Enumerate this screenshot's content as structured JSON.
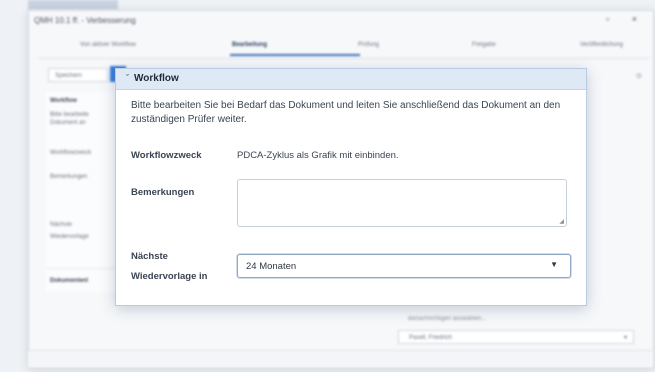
{
  "window": {
    "title": "QMH 10.1 ff. - Verbesserung",
    "controls": "▫ ×"
  },
  "steps": [
    {
      "label": "Von aktiver Workflow"
    },
    {
      "label": "Bearbeitung"
    },
    {
      "label": "Prüfung"
    },
    {
      "label": "Freigabe"
    },
    {
      "label": "Veröffentlichung"
    }
  ],
  "background": {
    "save_label": "Speichern",
    "left_items": [
      "Workflow",
      "Bitte bearbeite",
      "Dokument an",
      "Workflowzweck",
      "Bemerkungen",
      "Nächste",
      "Wiedervorlage",
      "Dokumentenl"
    ],
    "select_label": "Benachrichtigen auswählen...",
    "select_value": "Pasell, Friedrich",
    "right_icon": "⊙"
  },
  "dialog": {
    "title": "Workflow",
    "intro": "Bitte bearbeiten Sie bei Bedarf das Dokument und leiten Sie anschließend das Dokument an den zuständigen Prüfer weiter.",
    "workflowzweck_label": "Workflowzweck",
    "workflowzweck_value": "PDCA-Zyklus als Grafik mit einbinden.",
    "bemerkungen_label": "Bemerkungen",
    "bemerkungen_value": "",
    "wiedervorlage_label_line1": "Nächste",
    "wiedervorlage_label_line2": "Wiedervorlage in",
    "wiedervorlage_value": "24 Monaten"
  },
  "icons": {
    "collapse": "caret-down-icon",
    "select": "caret-down-icon"
  }
}
